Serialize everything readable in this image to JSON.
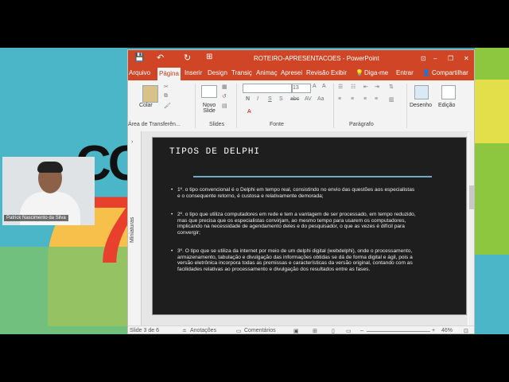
{
  "window": {
    "title": "ROTEIRO-APRESENTACOES - PowerPoint",
    "controls": {
      "minimize": "–",
      "restore": "❐",
      "close": "✕",
      "options": "⊡"
    }
  },
  "tabs": [
    "Arquivo",
    "Página",
    "Inserir",
    "Design",
    "Transiç",
    "Animaç",
    "Apresei",
    "Revisão",
    "Exibir"
  ],
  "tell_me": "Diga-me",
  "sign_in": "Entrar",
  "share": "Compartilhar",
  "ribbon": {
    "paste": "Colar",
    "new_slide": "Novo Slide",
    "font_size": "13",
    "design": "Desenho",
    "edit": "Edição",
    "groups": {
      "clipboard": "Área de Transferên...",
      "slides": "Slides",
      "font": "Fonte",
      "paragraph": "Parágrafo"
    }
  },
  "thumb_pane_label": "Miniaturas",
  "slide": {
    "title": "TIPOS DE DELPHI",
    "bullets": [
      "1º.      o tipo convencional é o Delphi em tempo real, consistindo no envio das questões aos especialistas e o consequente retorno, é custosa e relativamente demorada;",
      "2º.      o tipo que utiliza computadores em rede e tem a vantagem de ser processado, em tempo reduzido, mas que precisa que os especialistas convirjam, ao mesmo tempo para usarem os computadores, implicando na necessidade de agendamento deles e do pesquisador, o que as vezes é difícil para convergir;",
      "3º.      O tipo que se utiliza da internet por meio de um delphi digital (webdelphi), onde o processamento, armazenamento, tabulação e divulgação das informações obtidas se dá de forma digital e ágil, pois a versão eletrônica incorpora todas as premissas e características da versão original, contando com as facilidades relativas ao processamento e divulgação dos resultados entre as fases."
    ]
  },
  "status": {
    "slide": "Slide 3 de 6",
    "notes": "Anotações",
    "comments": "Comentários",
    "zoom": "46%"
  },
  "webcam": {
    "name": "Patrick Nascimento da Silva"
  },
  "background": {
    "text_c": "CO",
    "text_7": "7"
  }
}
